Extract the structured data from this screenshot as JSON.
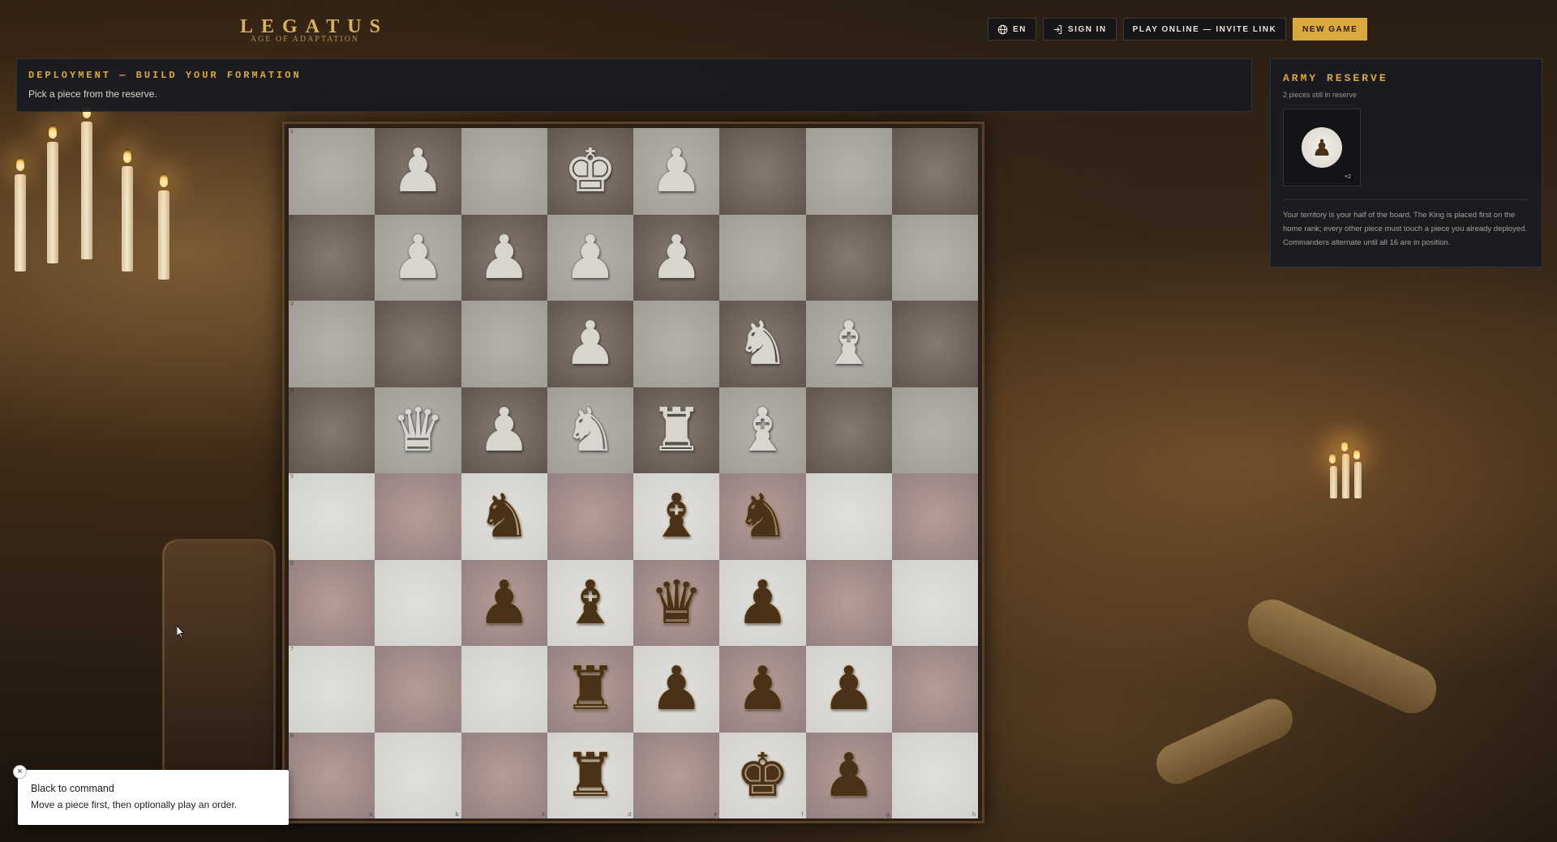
{
  "app": {
    "title": "LEGATUS",
    "subtitle": "AGE OF ADAPTATION"
  },
  "toolbar": {
    "language_label": "EN",
    "signin_label": "SIGN IN",
    "play_online_label": "PLAY ONLINE — INVITE LINK",
    "new_game_label": "NEW GAME"
  },
  "banner": {
    "title": "DEPLOYMENT — BUILD YOUR FORMATION",
    "instruction": "Pick a piece from the reserve."
  },
  "reserve": {
    "title": "ARMY RESERVE",
    "count_text": "2 pieces still in reserve",
    "piece": "♟",
    "piece_count": "×2",
    "help": "Your territory is your half of the board. The King is placed first on the home rank; every other piece must touch a piece you already deployed. Commanders alternate until all 16 are in position."
  },
  "toast": {
    "title": "Black to command",
    "body": "Move a piece first, then optionally play an order.",
    "close": "×"
  },
  "board": {
    "rank_labels": [
      "1",
      "2",
      "3",
      "4",
      "5",
      "6",
      "7",
      "8"
    ],
    "file_labels": [
      "a",
      "b",
      "c",
      "d",
      "e",
      "f",
      "g",
      "h"
    ],
    "rows": [
      [
        "",
        "wP",
        "",
        "wK",
        "wP",
        "",
        "",
        ""
      ],
      [
        "",
        "wP",
        "wP",
        "wP",
        "wP",
        "",
        "",
        ""
      ],
      [
        "",
        "",
        "",
        "wP",
        "",
        "wN",
        "wB",
        ""
      ],
      [
        "",
        "wQ",
        "wP",
        "wN",
        "wR",
        "wB",
        "",
        ""
      ],
      [
        "",
        "",
        "bN",
        "",
        "bB",
        "bN",
        "",
        ""
      ],
      [
        "",
        "",
        "bP",
        "bB",
        "bQ",
        "bP",
        "",
        ""
      ],
      [
        "",
        "",
        "",
        "bR",
        "bP",
        "bP",
        "bP",
        ""
      ],
      [
        "",
        "",
        "",
        "bR",
        "",
        "bK",
        "bP",
        ""
      ]
    ]
  },
  "colors": {
    "accent": "#d9a93f",
    "panel": "#181b22"
  }
}
